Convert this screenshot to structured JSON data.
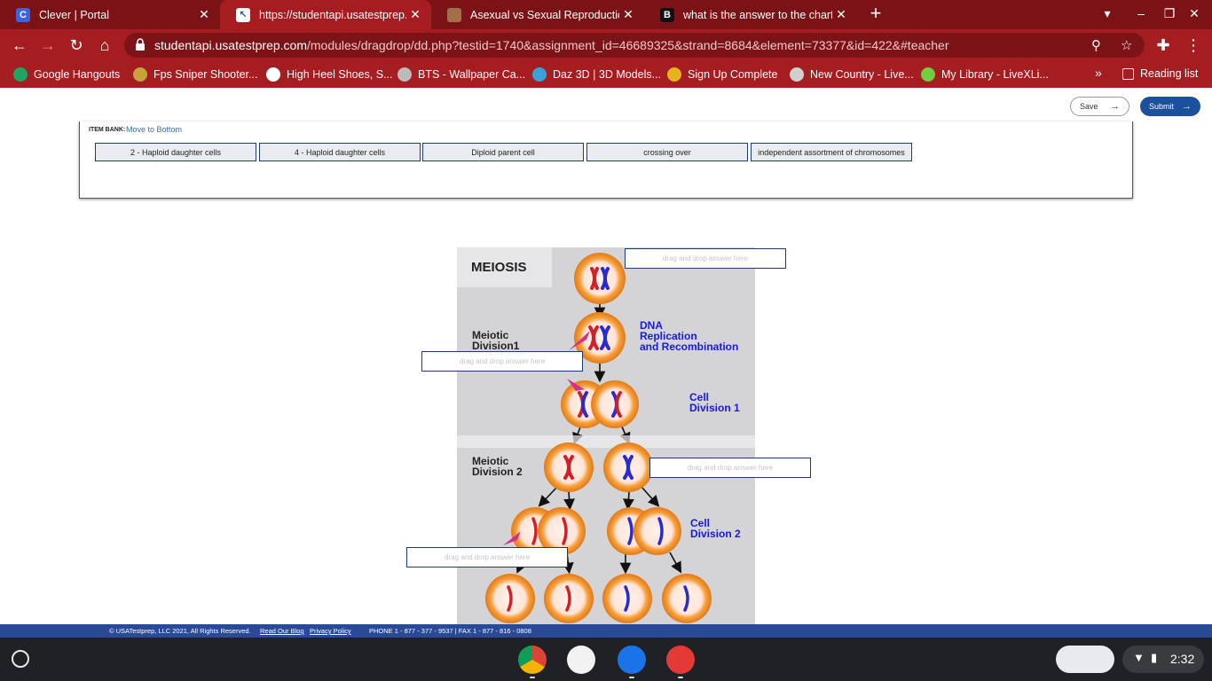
{
  "browser": {
    "tabs": [
      {
        "title": "Clever | Portal",
        "active": false
      },
      {
        "title": "https://studentapi.usatestprep.com",
        "active": true
      },
      {
        "title": "Asexual vs Sexual Reproduction",
        "active": false
      },
      {
        "title": "what is the answer to the chart",
        "active": false
      }
    ],
    "url_host": "studentapi.usatestprep.com",
    "url_path": "/modules/dragdrop/dd.php?testid=1740&assignment_id=46689325&strand=8684&element=73377&id=422&#teacher",
    "bookmarks": [
      {
        "label": "Google Hangouts",
        "color": "#1fa463"
      },
      {
        "label": "Fps Sniper Shooter...",
        "color": "#c8a23a"
      },
      {
        "label": "High Heel Shoes, S...",
        "color": "#ffffff"
      },
      {
        "label": "BTS - Wallpaper Ca...",
        "color": "#bbbbbb"
      },
      {
        "label": "Daz 3D | 3D Models...",
        "color": "#3aa0d8"
      },
      {
        "label": "Sign Up Complete",
        "color": "#e8b21c"
      },
      {
        "label": "New Country - Live...",
        "color": "#cfcfcf"
      },
      {
        "label": "My Library - LiveXLi...",
        "color": "#6fcf3f"
      }
    ],
    "more_label": "»",
    "reading_list": "Reading list"
  },
  "toolbar": {
    "save_label": "Save",
    "submit_label": "Submit"
  },
  "item_bank": {
    "label": "ITEM BANK:",
    "move_link": "Move to Bottom",
    "items": [
      "2 - Haploid daughter cells",
      "4 - Haploid daughter cells",
      "Diploid parent cell",
      "crossing over",
      "independent assortment of chromosomes"
    ]
  },
  "diagram": {
    "title": "MEIOSIS",
    "labels": {
      "meiotic1": [
        "Meiotic",
        "Division1"
      ],
      "dna": [
        "DNA",
        "Replication",
        "and Recombination"
      ],
      "cell1": [
        "Cell",
        "Division 1"
      ],
      "meiotic2": [
        "Meiotic",
        "Division 2"
      ],
      "cell2": [
        "Cell",
        "Division 2"
      ]
    },
    "dropzone_text": "drag and drop answer here"
  },
  "footer": {
    "copyright": "© USATestprep, LLC 2021, All Rights Reserved.",
    "blog": "Read Our Blog",
    "privacy": "Privacy Policy",
    "phone": "PHONE 1 - 877 - 377 - 9537 | FAX 1 - 877 - 816 - 0808"
  },
  "shelf": {
    "time": "2:32"
  },
  "colors": {
    "chrome_dark": "#7a1216",
    "chrome": "#a51c21",
    "submit": "#1c4f9c",
    "footer": "#2a4a96"
  }
}
